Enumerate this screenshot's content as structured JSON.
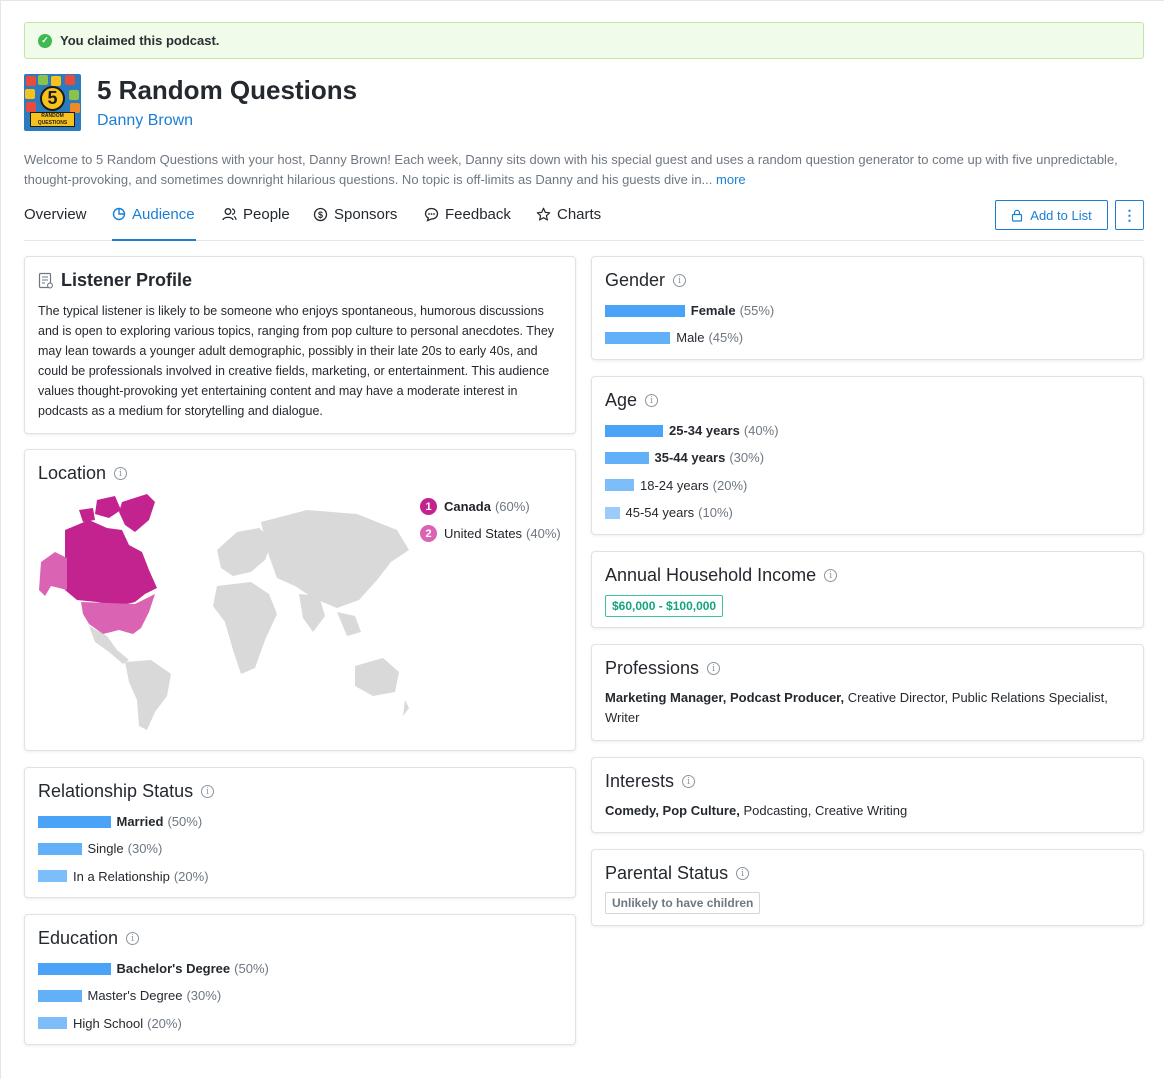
{
  "banner": {
    "text": "You claimed this podcast."
  },
  "podcast": {
    "title": "5 Random Questions",
    "host": "Danny Brown",
    "cover_number": "5",
    "cover_text": "RANDOM QUESTIONS",
    "description": "Welcome to 5 Random Questions with your host, Danny Brown! Each week, Danny sits down with his special guest and uses a random question generator to come up with five unpredictable, thought-provoking, and sometimes downright hilarious questions. No topic is off-limits as Danny and his guests dive in...",
    "more_label": "more"
  },
  "tabs": [
    {
      "label": "Overview",
      "icon": ""
    },
    {
      "label": "Audience",
      "icon": "pie-chart-icon",
      "active": true
    },
    {
      "label": "People",
      "icon": "people-icon"
    },
    {
      "label": "Sponsors",
      "icon": "dollar-icon"
    },
    {
      "label": "Feedback",
      "icon": "chat-icon"
    },
    {
      "label": "Charts",
      "icon": "star-icon"
    }
  ],
  "actions": {
    "add_to_list": "Add to List",
    "more": "⋮"
  },
  "colors": {
    "accent": "#1a7fd4",
    "bar1": "#4aa3f7",
    "bar2": "#62b0f8",
    "bar3": "#7dbdf9",
    "bar4": "#9acbfa",
    "canada": "#c2238e",
    "us": "#db63b4",
    "land": "#d9d9d9"
  },
  "listener_profile": {
    "title": "Listener Profile",
    "text": "The typical listener is likely to be someone who enjoys spontaneous, humorous discussions and is open to exploring various topics, ranging from pop culture to personal anecdotes. They may lean towards a younger adult demographic, possibly in their late 20s to early 40s, and could be professionals involved in creative fields, marketing, or entertainment. This audience values thought-provoking yet entertaining content and may have a moderate interest in podcasts as a medium for storytelling and dialogue."
  },
  "location": {
    "title": "Location",
    "items": [
      {
        "rank": "1",
        "name": "Canada",
        "pct": "(60%)"
      },
      {
        "rank": "2",
        "name": "United States",
        "pct": "(40%)"
      }
    ]
  },
  "relationship": {
    "title": "Relationship Status",
    "items": [
      {
        "label": "Married",
        "pct": "(50%)",
        "value": 50,
        "bold": true
      },
      {
        "label": "Single",
        "pct": "(30%)",
        "value": 30
      },
      {
        "label": "In a Relationship",
        "pct": "(20%)",
        "value": 20
      }
    ]
  },
  "education": {
    "title": "Education",
    "items": [
      {
        "label": "Bachelor's Degree",
        "pct": "(50%)",
        "value": 50,
        "bold": true
      },
      {
        "label": "Master's Degree",
        "pct": "(30%)",
        "value": 30
      },
      {
        "label": "High School",
        "pct": "(20%)",
        "value": 20
      }
    ]
  },
  "gender": {
    "title": "Gender",
    "items": [
      {
        "label": "Female",
        "pct": "(55%)",
        "value": 55,
        "bold": true
      },
      {
        "label": "Male",
        "pct": "(45%)",
        "value": 45
      }
    ]
  },
  "age": {
    "title": "Age",
    "items": [
      {
        "label": "25-34 years",
        "pct": "(40%)",
        "value": 40,
        "bold": true
      },
      {
        "label": "35-44 years",
        "pct": "(30%)",
        "value": 30,
        "bold": true
      },
      {
        "label": "18-24 years",
        "pct": "(20%)",
        "value": 20
      },
      {
        "label": "45-54 years",
        "pct": "(10%)",
        "value": 10
      }
    ]
  },
  "income": {
    "title": "Annual Household Income",
    "value": "$60,000 - $100,000"
  },
  "professions": {
    "title": "Professions",
    "bold": "Marketing Manager, Podcast Producer,",
    "rest": " Creative Director, Public Relations Specialist, Writer"
  },
  "interests": {
    "title": "Interests",
    "bold": "Comedy, Pop Culture,",
    "rest": " Podcasting, Creative Writing"
  },
  "parental": {
    "title": "Parental Status",
    "value": "Unlikely to have children"
  }
}
